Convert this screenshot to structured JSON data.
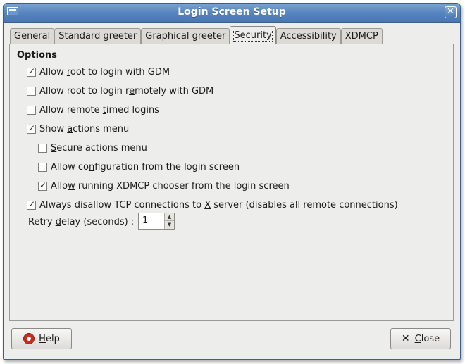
{
  "window": {
    "title": "Login Screen Setup",
    "close_glyph": "✕"
  },
  "tabs": [
    {
      "label": "General",
      "active": false
    },
    {
      "label": "Standard greeter",
      "active": false
    },
    {
      "label": "Graphical greeter",
      "active": false
    },
    {
      "label": "Security",
      "active": true
    },
    {
      "label": "Accessibility",
      "active": false
    },
    {
      "label": "XDMCP",
      "active": false
    }
  ],
  "options": {
    "title": "Options",
    "items": [
      {
        "label_pre": "Allow ",
        "mnemonic": "r",
        "label_post": "oot to login with GDM",
        "checked": true
      },
      {
        "label_pre": "Allow root to login r",
        "mnemonic": "e",
        "label_post": "motely with GDM",
        "checked": false
      },
      {
        "label_pre": "Allow remote ",
        "mnemonic": "t",
        "label_post": "imed logins",
        "checked": false
      },
      {
        "label_pre": "Show ",
        "mnemonic": "a",
        "label_post": "ctions menu",
        "checked": true
      },
      {
        "label_pre": "",
        "mnemonic": "S",
        "label_post": "ecure actions menu",
        "checked": false
      },
      {
        "label_pre": "Allow co",
        "mnemonic": "n",
        "label_post": "figuration from the login screen",
        "checked": false
      },
      {
        "label_pre": "Allo",
        "mnemonic": "w",
        "label_post": " running XDMCP chooser from the login screen",
        "checked": true
      },
      {
        "label_pre": "Always disallow TCP connections to ",
        "mnemonic": "X",
        "label_post": " server (disables all remote connections)",
        "checked": true
      }
    ]
  },
  "retry": {
    "label_pre": "Retry ",
    "mnemonic": "d",
    "label_post": "elay (seconds) :",
    "value": "1"
  },
  "buttons": {
    "help_mnemonic": "H",
    "help_rest": "elp",
    "close_mnemonic": "C",
    "close_rest": "lose"
  },
  "icons": {
    "help": "lifebuoy-icon",
    "close": "x-icon",
    "check": "checkmark-icon"
  },
  "colors": {
    "titlebar": "#5785bf",
    "window_bg": "#ededeb"
  }
}
